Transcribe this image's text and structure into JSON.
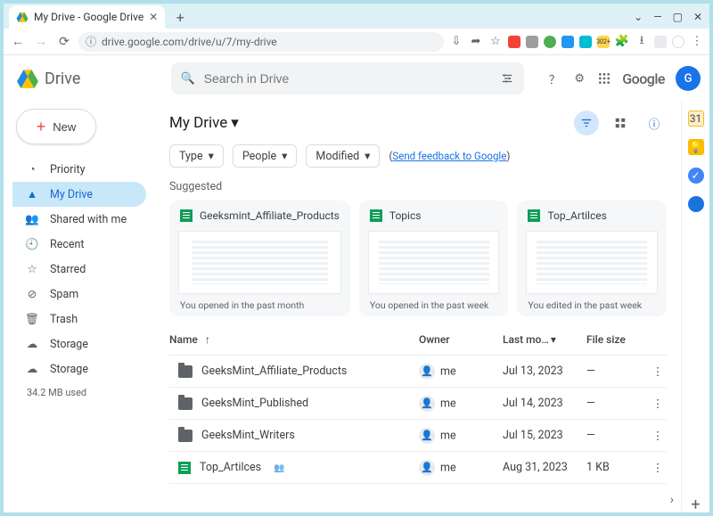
{
  "browser": {
    "tab_title": "My Drive - Google Drive",
    "url": "drive.google.com/drive/u/7/my-drive",
    "badge": "302+"
  },
  "header": {
    "product": "Drive",
    "search_placeholder": "Search in Drive",
    "brand": "Google",
    "avatar_letter": "G"
  },
  "sidebar": {
    "new_label": "New",
    "items": [
      {
        "label": "Priority",
        "icon": "priority-icon"
      },
      {
        "label": "My Drive",
        "icon": "drive-icon",
        "active": true
      },
      {
        "label": "Shared with me",
        "icon": "shared-icon"
      },
      {
        "label": "Recent",
        "icon": "recent-icon"
      },
      {
        "label": "Starred",
        "icon": "star-icon"
      },
      {
        "label": "Spam",
        "icon": "spam-icon"
      },
      {
        "label": "Trash",
        "icon": "trash-icon"
      },
      {
        "label": "Storage",
        "icon": "storage-icon"
      },
      {
        "label": "Storage",
        "icon": "storage-icon"
      }
    ],
    "storage_used": "34.2 MB used"
  },
  "main": {
    "title": "My Drive",
    "filters": {
      "type": "Type",
      "people": "People",
      "modified": "Modified"
    },
    "feedback_prefix": "(",
    "feedback_text": "Send feedback to Google",
    "feedback_suffix": ")",
    "suggested_label": "Suggested",
    "cards": [
      {
        "title": "Geeksmint_Affiliate_Products",
        "subtitle": "You opened in the past month",
        "type": "sheets"
      },
      {
        "title": "Topics",
        "subtitle": "You opened in the past week",
        "type": "sheets"
      },
      {
        "title": "Top_Artilces",
        "subtitle": "You edited in the past week",
        "type": "sheets"
      }
    ],
    "columns": {
      "name": "Name",
      "owner": "Owner",
      "modified": "Last mo…",
      "size": "File size"
    },
    "rows": [
      {
        "icon": "folder",
        "name": "GeeksMint_Affiliate_Products",
        "owner": "me",
        "modified": "Jul 13, 2023",
        "size": "—"
      },
      {
        "icon": "folder",
        "name": "GeeksMint_Published",
        "owner": "me",
        "modified": "Jul 14, 2023",
        "size": "—"
      },
      {
        "icon": "folder",
        "name": "GeeksMint_Writers",
        "owner": "me",
        "modified": "Jul 15, 2023",
        "size": "—"
      },
      {
        "icon": "sheets",
        "name": "Top_Artilces",
        "owner": "me",
        "modified": "Aug 31, 2023",
        "size": "1 KB",
        "shared": true
      }
    ]
  }
}
